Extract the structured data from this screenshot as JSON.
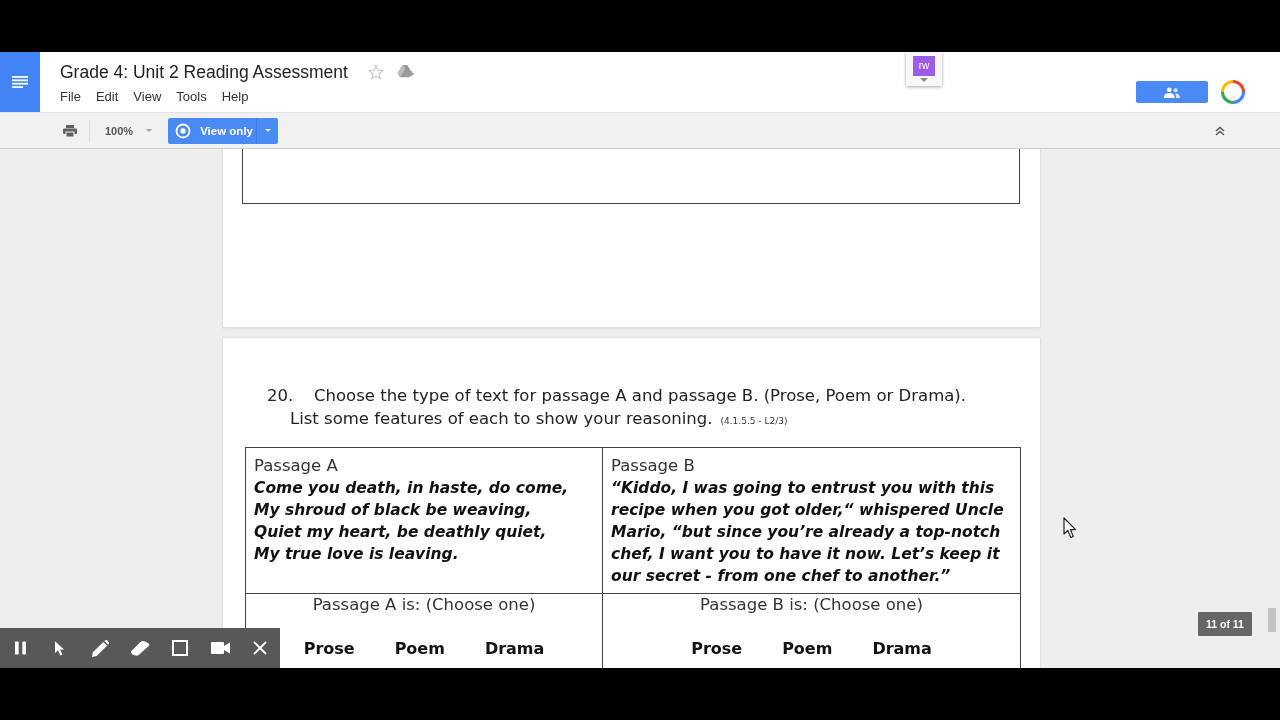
{
  "doc_header": {
    "title": "Grade 4: Unit 2 Reading Assessment",
    "starred": false,
    "menu": [
      "File",
      "Edit",
      "View",
      "Tools",
      "Help"
    ]
  },
  "toolbar": {
    "zoom": "100%",
    "mode_button": "View only"
  },
  "extension": {
    "label": "rw"
  },
  "question": {
    "number": "20.",
    "sentence_1": "Choose the type of text for passage A and passage B. (Prose, Poem or Drama).",
    "sentence_2": "List some features of each to show your reasoning.",
    "standard": "(4.1.5.5 - L2/3)"
  },
  "passages": [
    {
      "heading": "Passage A",
      "text": "Come you death, in haste, do come,\nMy shroud of black be weaving,\nQuiet my heart, be deathly quiet,\nMy true love is leaving.",
      "prompt": "Passage A is: (Choose one)",
      "options": [
        "Prose",
        "Poem",
        "Drama"
      ]
    },
    {
      "heading": "Passage B",
      "text": "“Kiddo, I was going to entrust you with this recipe when you got older,“ whispered Uncle Mario, “but since you’re already a top-notch chef, I want you to have it now. Let’s keep it our secret - from one chef to another.”",
      "prompt": "Passage B is: (Choose one)",
      "options": [
        "Prose",
        "Poem",
        "Drama"
      ]
    }
  ],
  "page_count": "11 of 11"
}
